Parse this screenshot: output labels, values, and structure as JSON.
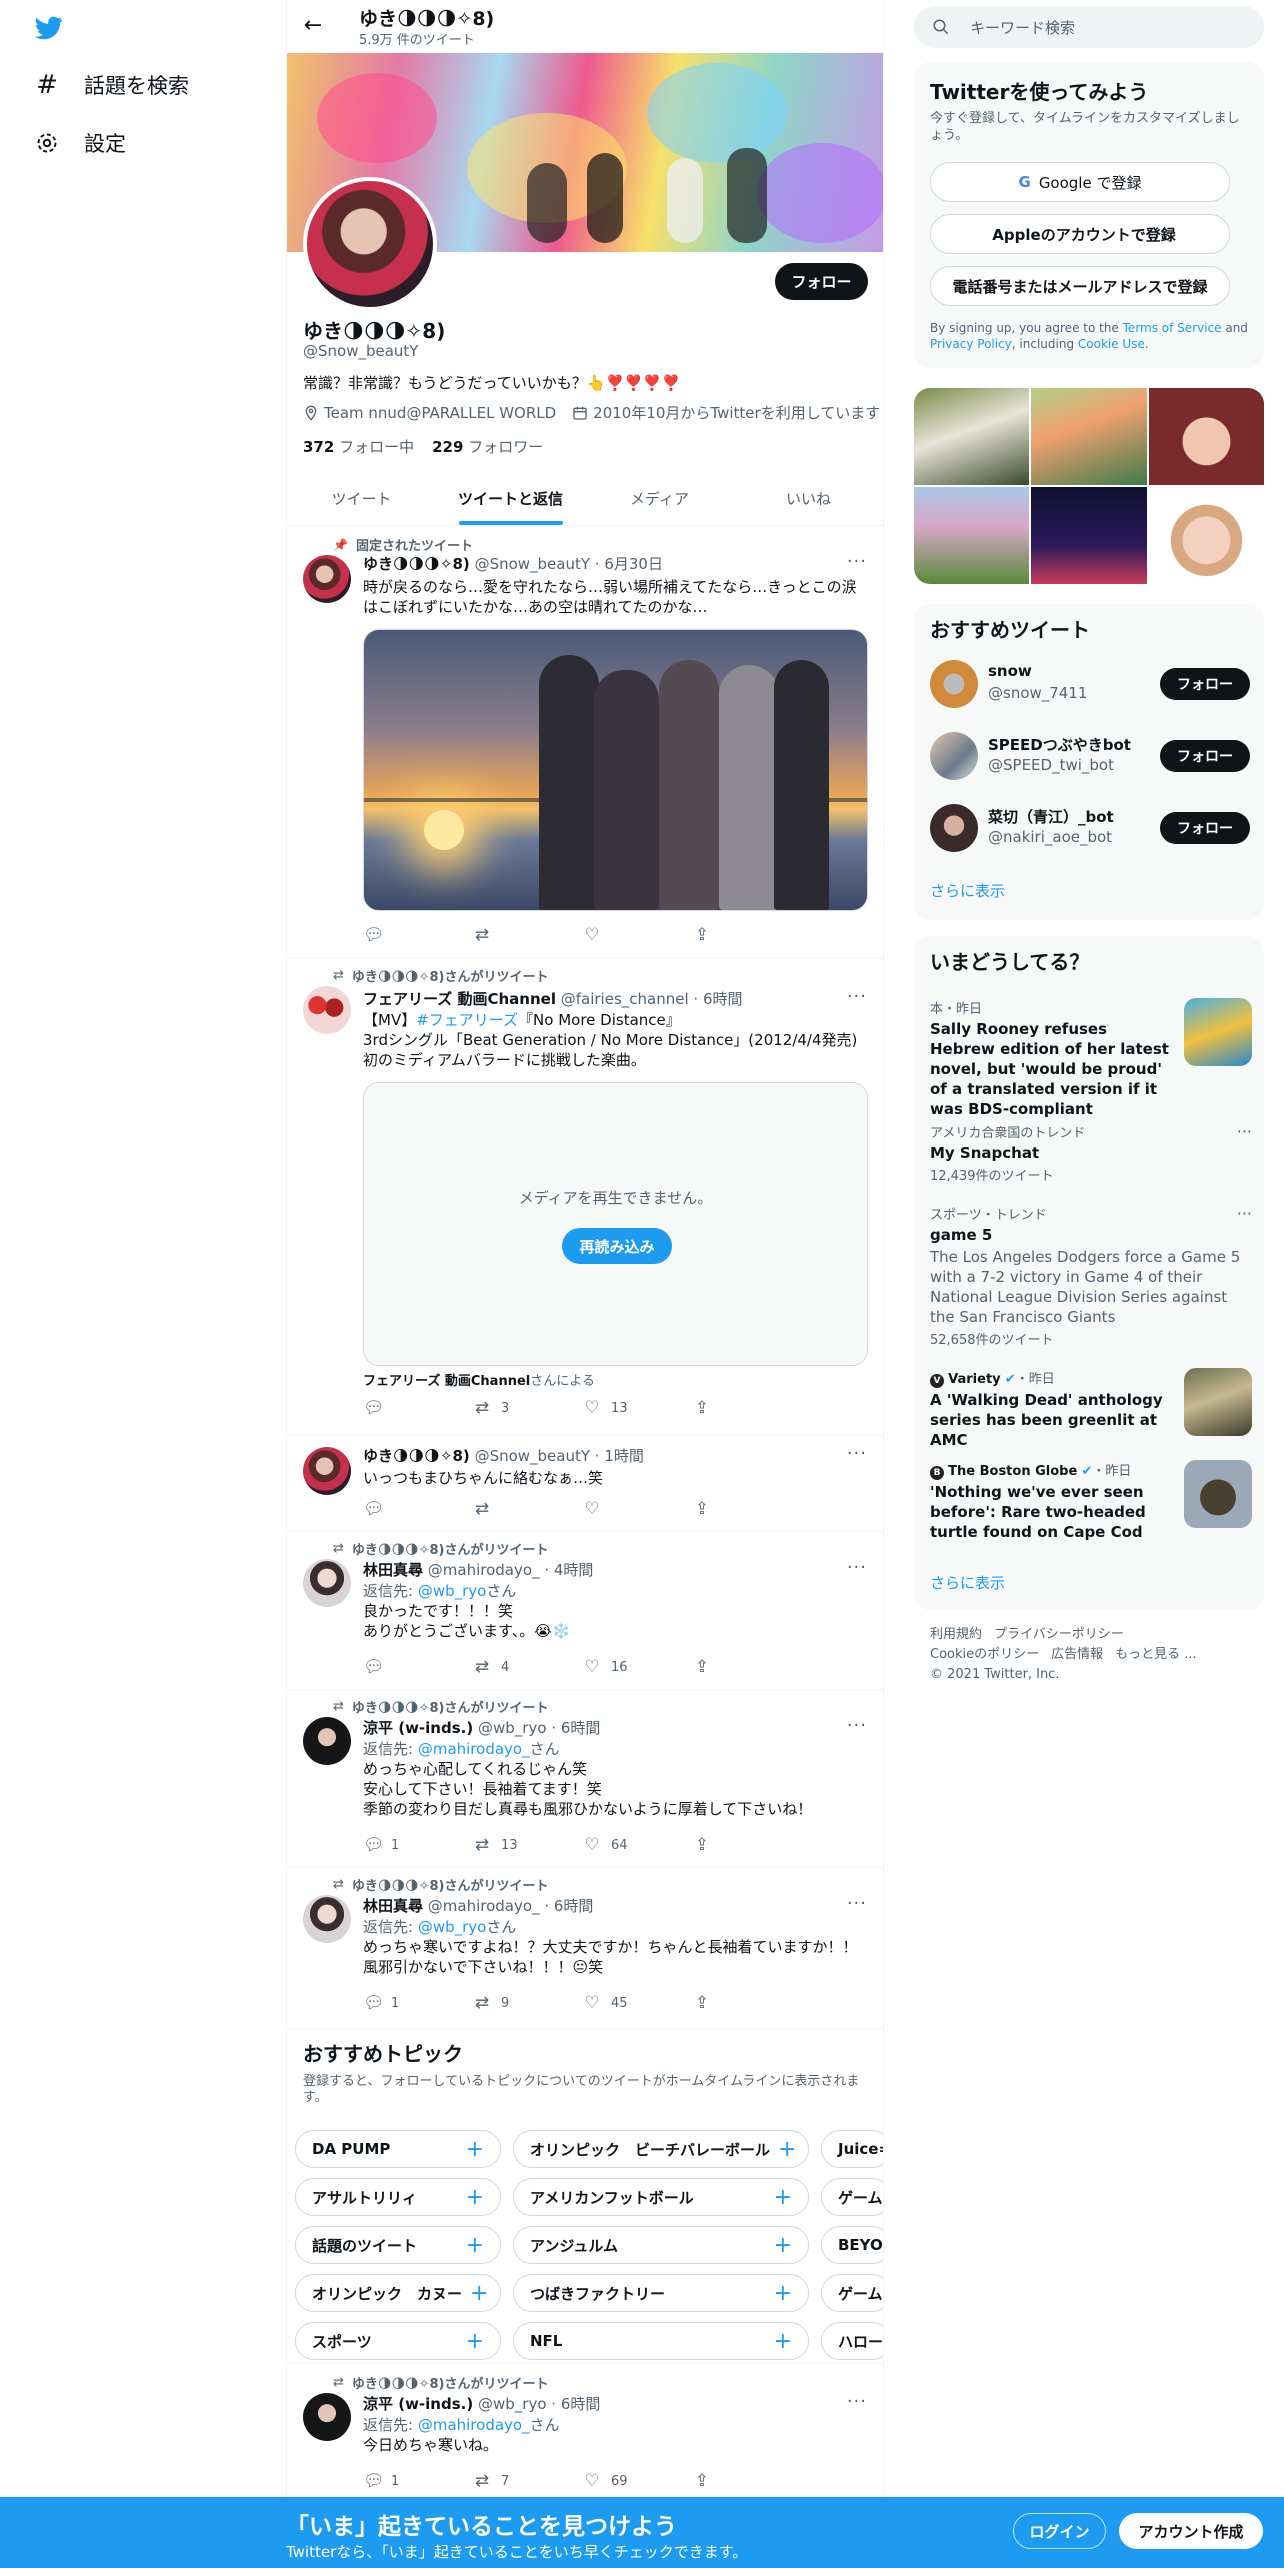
{
  "nav": {
    "logo": "twitter-bird",
    "items": [
      {
        "label": "話題を検索",
        "icon": "hashtag-icon"
      },
      {
        "label": "設定",
        "icon": "gear-icon"
      }
    ]
  },
  "header": {
    "name": "ゆき🌗🌗🌗✧8)",
    "tweet_count": "5.9万 件のツイート"
  },
  "profile": {
    "follow_label": "フォロー",
    "name": "ゆき🌗🌗🌗✧8)",
    "handle": "@Snow_beautY",
    "bio": "常識？非常識？もうどうだっていいかも？👆❣️❣️❣️❣️",
    "location": "Team nnud@PARALLEL WORLD",
    "joined": "2010年10月からTwitterを利用しています",
    "following_count": "372",
    "following_label": "フォロー中",
    "followers_count": "229",
    "followers_label": "フォロワー"
  },
  "tabs": [
    "ツイート",
    "ツイートと返信",
    "メディア",
    "いいね"
  ],
  "active_tab": 1,
  "tweets": [
    {
      "context": "固定されたツイート",
      "name": "ゆき🌗🌗🌗✧8)",
      "handle": "@Snow_beautY",
      "time": "6月30日",
      "text": "時が戻るのなら…愛を守れたなら…弱い場所補えてたなら…きっとこの涙はこぼれずにいたかな…あの空は晴れてたのかな…",
      "reply": "",
      "retweet": "",
      "like": ""
    },
    {
      "context": "ゆき🌗🌗🌗✧8)さんがリツイート",
      "name": "フェアリーズ 動画Channel",
      "handle": "@fairies_channel",
      "time": "6時間",
      "text_line1_pre": "【MV】",
      "hashtag": "#フェアリーズ",
      "text_line1_post": "『No More Distance』",
      "text_line2": "3rdシングル「Beat Generation / No More Distance」(2012/4/4発売)",
      "text_line3": "初のミディアムバラードに挑戦した楽曲。",
      "media_message": "メディアを再生できません。",
      "reload_label": "再読み込み",
      "attribution": "フェアリーズ 動画Channel",
      "attribution_suffix": "さんによる",
      "reply": "",
      "retweet": "3",
      "like": "13"
    },
    {
      "context": "",
      "name": "ゆき🌗🌗🌗✧8)",
      "handle": "@Snow_beautY",
      "time": "1時間",
      "text": "いっつもまひちゃんに絡むなぁ…笑",
      "reply": "",
      "retweet": "",
      "like": ""
    },
    {
      "context": "ゆき🌗🌗🌗✧8)さんがリツイート",
      "name": "林田真尋",
      "handle": "@mahirodayo_",
      "time": "4時間",
      "reply_prefix": "返信先: ",
      "reply_to": "@wb_ryo",
      "reply_suffix": "さん",
      "text_line1": "良かったです！！！笑",
      "text_line2": "ありがとうございます、。😭❄️",
      "reply": "",
      "retweet": "4",
      "like": "16"
    },
    {
      "context": "ゆき🌗🌗🌗✧8)さんがリツイート",
      "name": "涼平 (w-inds.)",
      "handle": "@wb_ryo",
      "time": "6時間",
      "reply_prefix": "返信先: ",
      "reply_to": "@mahirodayo_",
      "reply_suffix": "さん",
      "text_line1": "めっちゃ心配してくれるじゃん笑",
      "text_line2": "安心して下さい！長袖着てます！笑",
      "text_line3": "季節の変わり目だし真尋も風邪ひかないように厚着して下さいね！",
      "reply": "1",
      "retweet": "13",
      "like": "64"
    },
    {
      "context": "ゆき🌗🌗🌗✧8)さんがリツイート",
      "name": "林田真尋",
      "handle": "@mahirodayo_",
      "time": "6時間",
      "reply_prefix": "返信先: ",
      "reply_to": "@wb_ryo",
      "reply_suffix": "さん",
      "text_line1": "めっちゃ寒いですよね！？大丈夫ですか！ちゃんと長袖着ていますか！！",
      "text_line2": "風邪引かないで下さいね！！！😐笑",
      "reply": "1",
      "retweet": "9",
      "like": "45"
    },
    {
      "context": "ゆき🌗🌗🌗✧8)さんがリツイート",
      "name": "涼平 (w-inds.)",
      "handle": "@wb_ryo",
      "time": "6時間",
      "reply_prefix": "返信先: ",
      "reply_to": "@mahirodayo_",
      "reply_suffix": "さん",
      "text_line1": "今日めちゃ寒いね。",
      "reply": "1",
      "retweet": "7",
      "like": "69"
    }
  ],
  "topics": {
    "title": "おすすめトピック",
    "subtitle": "登録すると、フォローしているトピックについてのツイートがホームタイムラインに表示されます。",
    "rows": [
      [
        "DA PUMP",
        "オリンピック　ビーチバレーボール",
        "Juice="
      ],
      [
        "アサルトリリィ",
        "アメリカンフットボール",
        "ゲーム"
      ],
      [
        "話題のツイート",
        "アンジュルム",
        "BEYO"
      ],
      [
        "オリンピック　カヌー",
        "つばきファクトリー",
        "ゲーム"
      ],
      [
        "スポーツ",
        "NFL",
        "ハロー"
      ]
    ]
  },
  "right": {
    "search_placeholder": "キーワード検索",
    "signup": {
      "title": "Twitterを使ってみよう",
      "subtitle": "今すぐ登録して、タイムラインをカスタマイズしましょう。",
      "google": "Google で登録",
      "apple": "Appleのアカウントで登録",
      "phone": "電話番号またはメールアドレスで登録",
      "legal_pre": "By signing up, you agree to the ",
      "tos": "Terms of Service",
      "legal_and": " and ",
      "privacy": "Privacy Policy",
      "legal_including": ", including ",
      "cookie": "Cookie Use",
      "legal_end": "."
    },
    "who_to_follow": {
      "title": "おすすめツイート",
      "users": [
        {
          "name": "snow",
          "handle": "@snow_7411",
          "button": "フォロー"
        },
        {
          "name": "SPEEDつぶやきbot",
          "handle": "@SPEED_twi_bot",
          "button": "フォロー"
        },
        {
          "name": "菜切（青江）_bot",
          "handle": "@nakiri_aoe_bot",
          "button": "フォロー"
        }
      ],
      "show_more": "さらに表示"
    },
    "trends": {
      "title": "いまどうしてる？",
      "items": [
        {
          "meta": "本・昨日",
          "name": "Sally Rooney refuses Hebrew edition of her latest novel, but 'would be proud' of a translated version if it was BDS-compliant"
        },
        {
          "meta": "アメリカ合衆国のトレンド",
          "name": "My Snapchat",
          "count": "12,439件のツイート"
        },
        {
          "meta": "スポーツ・トレンド",
          "name": "game 5",
          "desc": "The Los Angeles Dodgers force a Game 5 with a 7-2 victory in Game 4 of their National League Division Series against the San Francisco Giants",
          "count": "52,658件のツイート"
        },
        {
          "source": "Variety",
          "time": "・昨日",
          "name": "A 'Walking Dead' anthology series has been greenlit at AMC"
        },
        {
          "source": "The Boston Globe",
          "time": "・昨日",
          "name": "'Nothing we've ever seen before': Rare two-headed turtle found on Cape Cod"
        }
      ],
      "show_more": "さらに表示"
    },
    "footer": {
      "links": [
        "利用規約",
        "プライバシーポリシー",
        "Cookieのポリシー",
        "広告情報",
        "もっと見る ..."
      ],
      "copyright": "© 2021 Twitter, Inc."
    }
  },
  "bottom": {
    "title": "「いま」起きていることを見つけよう",
    "subtitle": "Twitterなら、「いま」起きていることをいち早くチェックできます。",
    "login": "ログイン",
    "signup": "アカウント作成"
  },
  "colors": {
    "accent": "#1d9bf0",
    "text": "#0f1419",
    "muted": "#536471"
  }
}
